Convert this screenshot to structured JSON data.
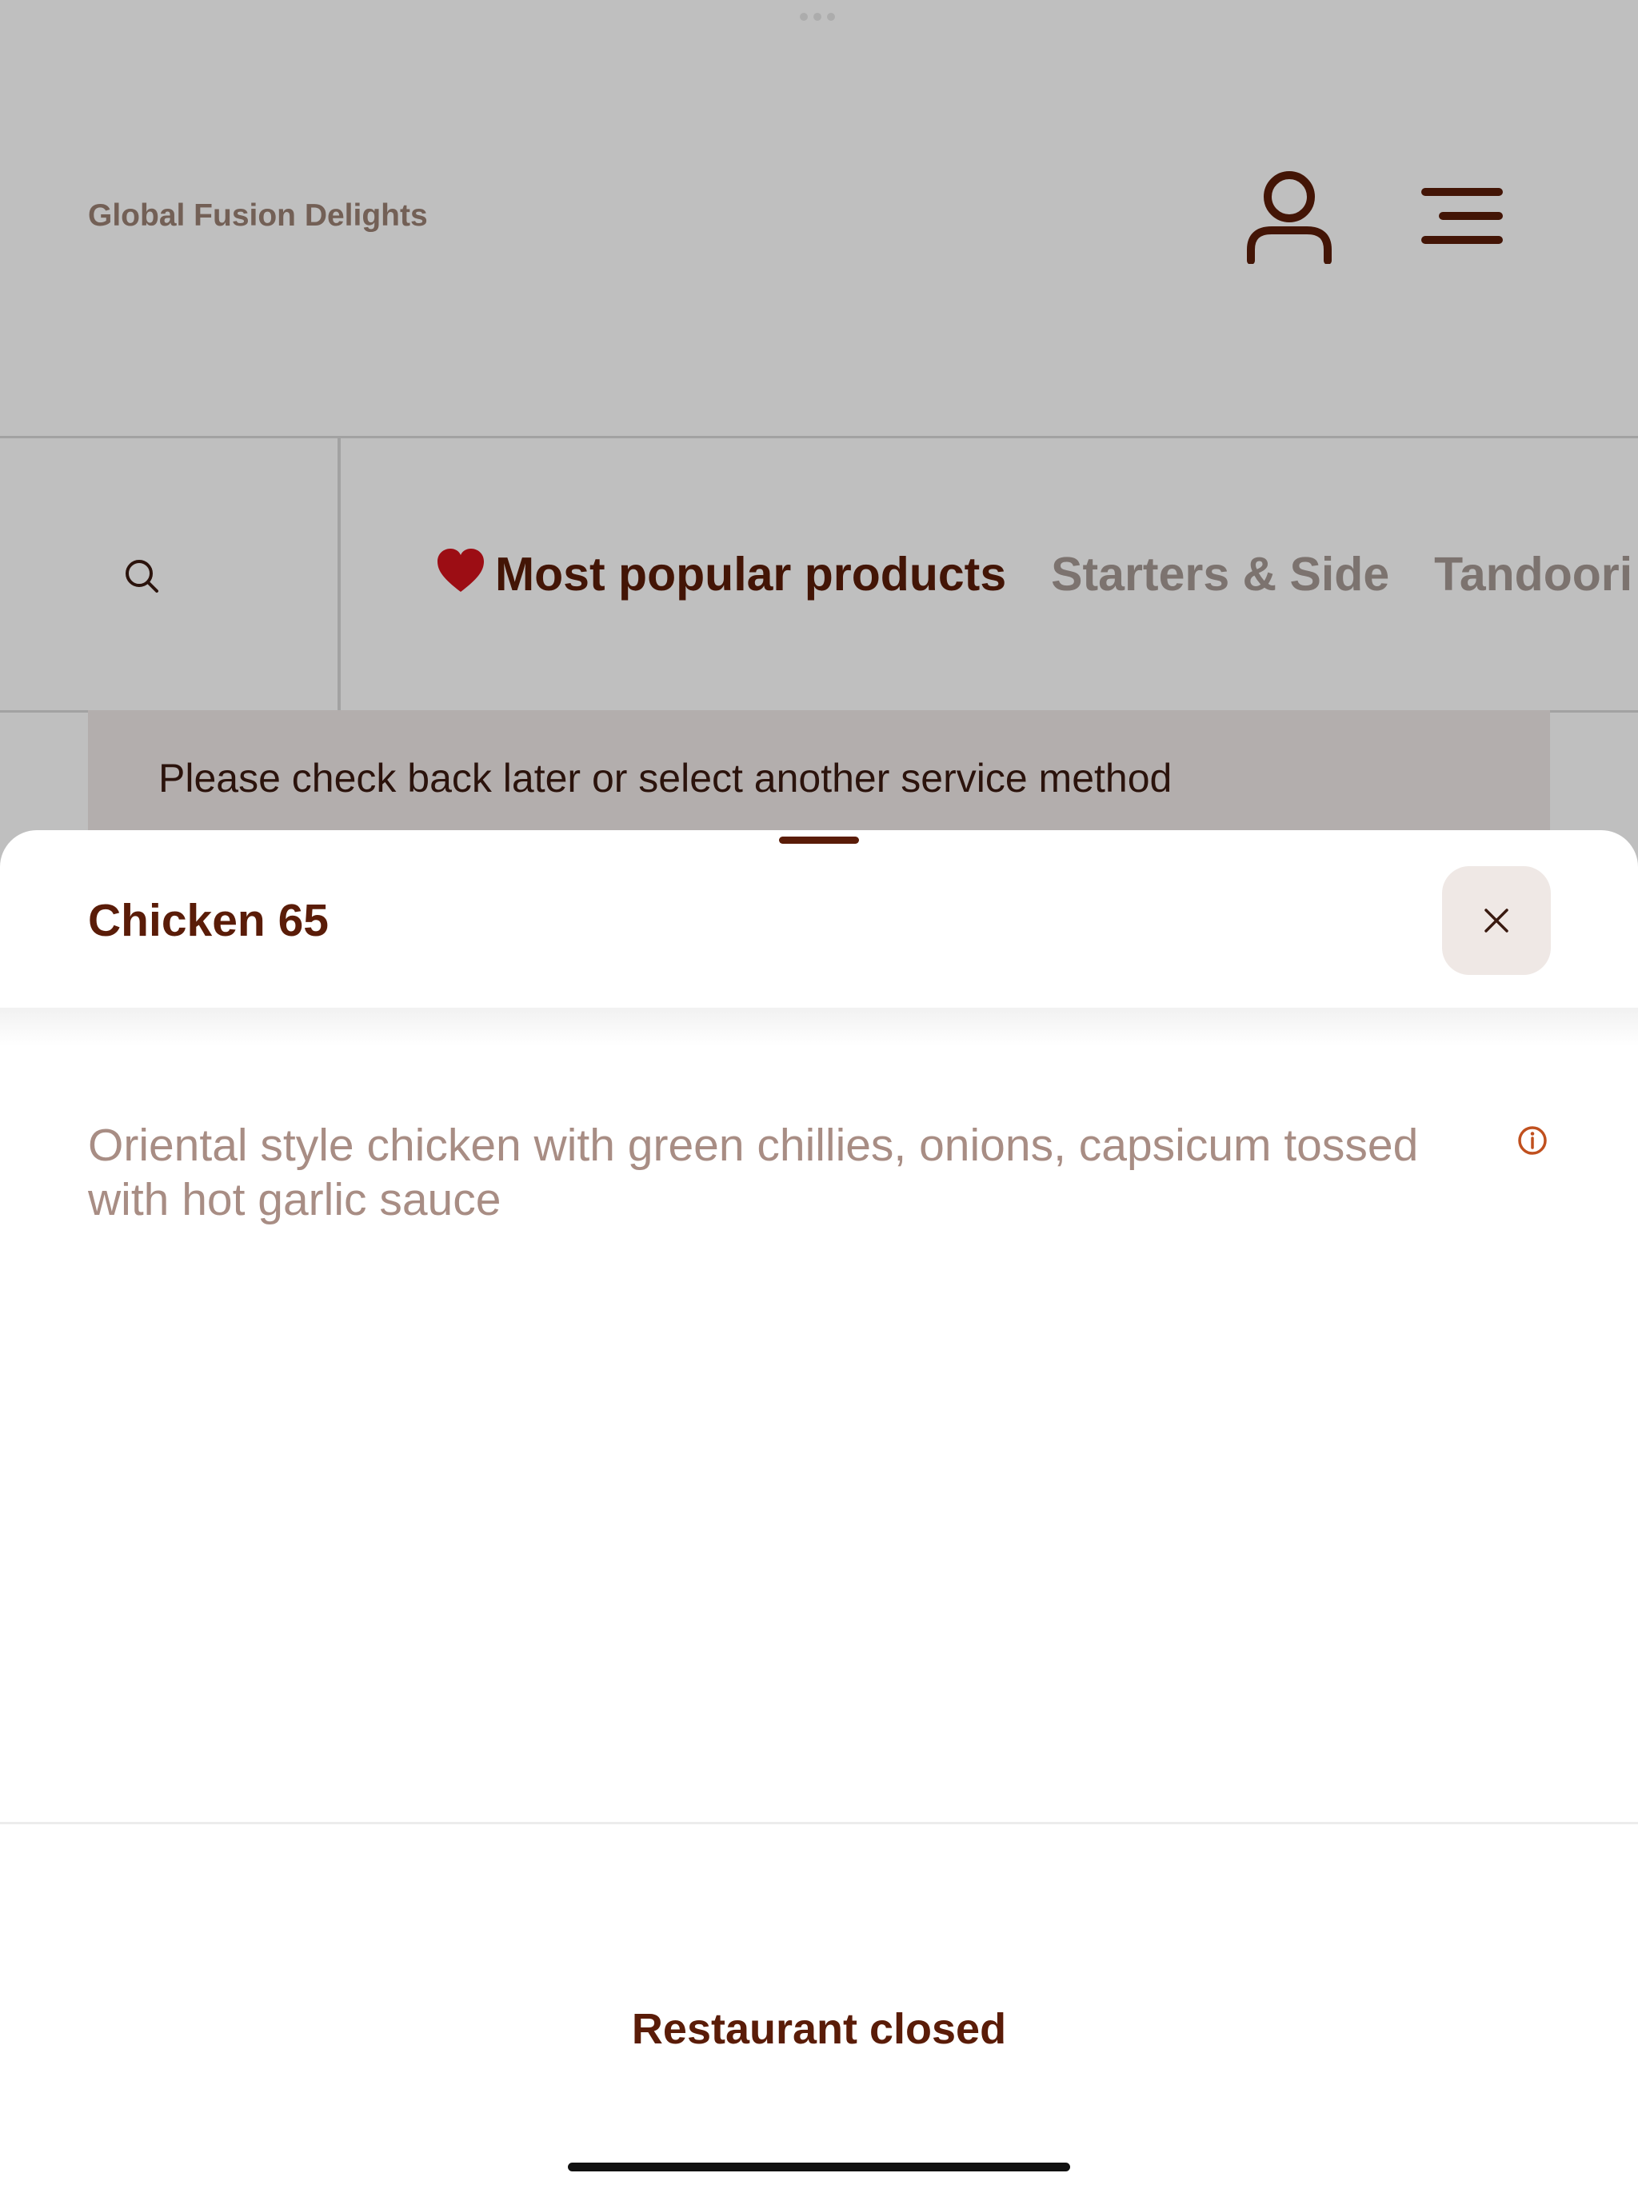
{
  "header": {
    "brand": "Global Fusion Delights",
    "account_icon": "user-icon",
    "menu_icon": "hamburger-menu-icon"
  },
  "nav": {
    "search_icon": "search-icon",
    "categories": [
      {
        "label": "Most popular products",
        "icon": "heart-icon",
        "active": true
      },
      {
        "label": "Starters & Side",
        "active": false
      },
      {
        "label": "Tandoori S",
        "active": false
      }
    ]
  },
  "notice": {
    "message": "Please check back later or select another service method"
  },
  "sheet": {
    "title": "Chicken 65",
    "close_icon": "close-icon",
    "description": "Oriental style chicken with green chillies, onions, capsicum tossed with hot garlic sauce",
    "info_icon": "info-icon",
    "status": "Restaurant closed"
  },
  "colors": {
    "primary": "#5a1c08",
    "muted_text": "#a88d84",
    "brand_text": "#9a8073",
    "close_button_bg": "#efe8e5",
    "accent_info": "#c0501e"
  }
}
